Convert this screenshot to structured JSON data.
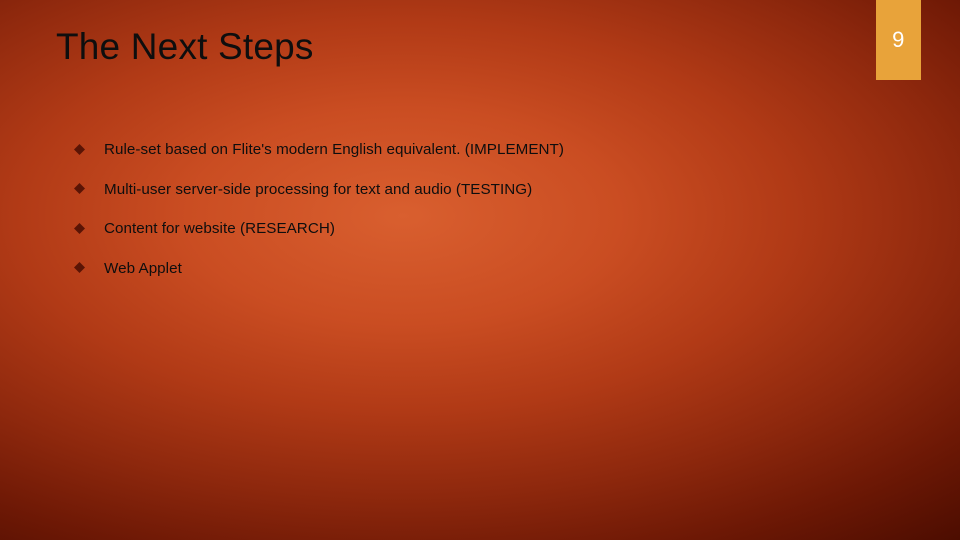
{
  "slide": {
    "title": "The Next Steps",
    "page_number": "9",
    "bullets": [
      {
        "text": "Rule-set based on Flite's modern English equivalent. (IMPLEMENT)"
      },
      {
        "text": "Multi-user server-side processing for text and audio (TESTING)"
      },
      {
        "text": "Content for website (RESEARCH)"
      },
      {
        "text": "Web Applet"
      }
    ],
    "colors": {
      "accent": "#e8a33a",
      "bullet": "#5a1405"
    }
  }
}
